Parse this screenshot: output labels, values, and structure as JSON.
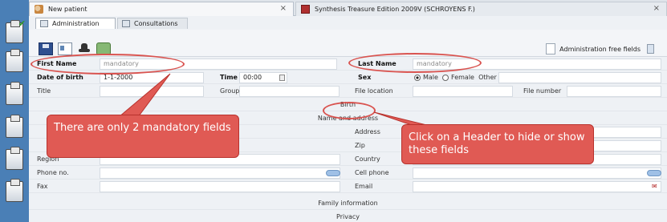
{
  "tabs": [
    {
      "label": "New patient",
      "close": "×"
    },
    {
      "label": "Synthesis Treasure Edition 2009V (SCHROYENS F.)",
      "close": "×"
    }
  ],
  "subtabs": [
    {
      "label": "Administration"
    },
    {
      "label": "Consultations"
    }
  ],
  "toolbar": {
    "admin_free_fields": "Administration free fields"
  },
  "form": {
    "first_name_label": "First Name",
    "first_name_placeholder": "mandatory",
    "last_name_label": "Last Name",
    "last_name_placeholder": "mandatory",
    "dob_label": "Date of birth",
    "dob_value": "1-1-2000",
    "time_label": "Time",
    "time_value": "00:00",
    "sex_label": "Sex",
    "sex_options": [
      "Male",
      "Female",
      "Other"
    ],
    "title_label": "Title",
    "group_label": "Group",
    "file_location_label": "File location",
    "file_number_label": "File number",
    "birth_header": "Birth",
    "name_address_header": "Name and address",
    "address_label": "Address",
    "zip_label": "Zip",
    "region_label": "Region",
    "country_label": "Country",
    "phone_label": "Phone no.",
    "cell_phone_label": "Cell phone",
    "fax_label": "Fax",
    "email_label": "Email",
    "family_header": "Family information",
    "privacy_header": "Privacy"
  },
  "annotations": {
    "mandatory_note": "There are only 2 mandatory fields",
    "header_note": "Click on a Header to hide or show these fields"
  },
  "colors": {
    "sidebar": "#4a7fb6",
    "annotation": "#e05a54",
    "ellipse": "#d9534f"
  }
}
